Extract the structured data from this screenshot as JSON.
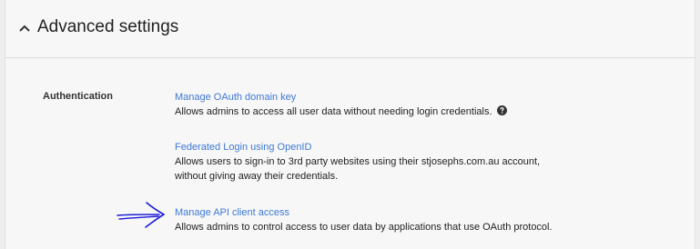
{
  "header": {
    "title": "Advanced settings",
    "toggle_icon": "chevron-up-icon"
  },
  "section": {
    "label": "Authentication",
    "items": [
      {
        "link": "Manage OAuth domain key",
        "description": "Allows admins to access all user data without needing login credentials.",
        "help_icon": "question-circle-icon"
      },
      {
        "link": "Federated Login using OpenID",
        "description_line1": "Allows users to sign-in to 3rd party websites using their stjosephs.com.au account,",
        "description_line2": "without giving away their credentials."
      },
      {
        "link": "Manage API client access",
        "description": "Allows admins to control access to user data by applications that use OAuth protocol."
      }
    ]
  },
  "annotation": {
    "icon": "hand-drawn-arrow-icon",
    "color": "#1a1adb"
  },
  "colors": {
    "link": "#3d79d6",
    "panel_background": "#f7f7f7",
    "page_background": "#eeeeee"
  }
}
